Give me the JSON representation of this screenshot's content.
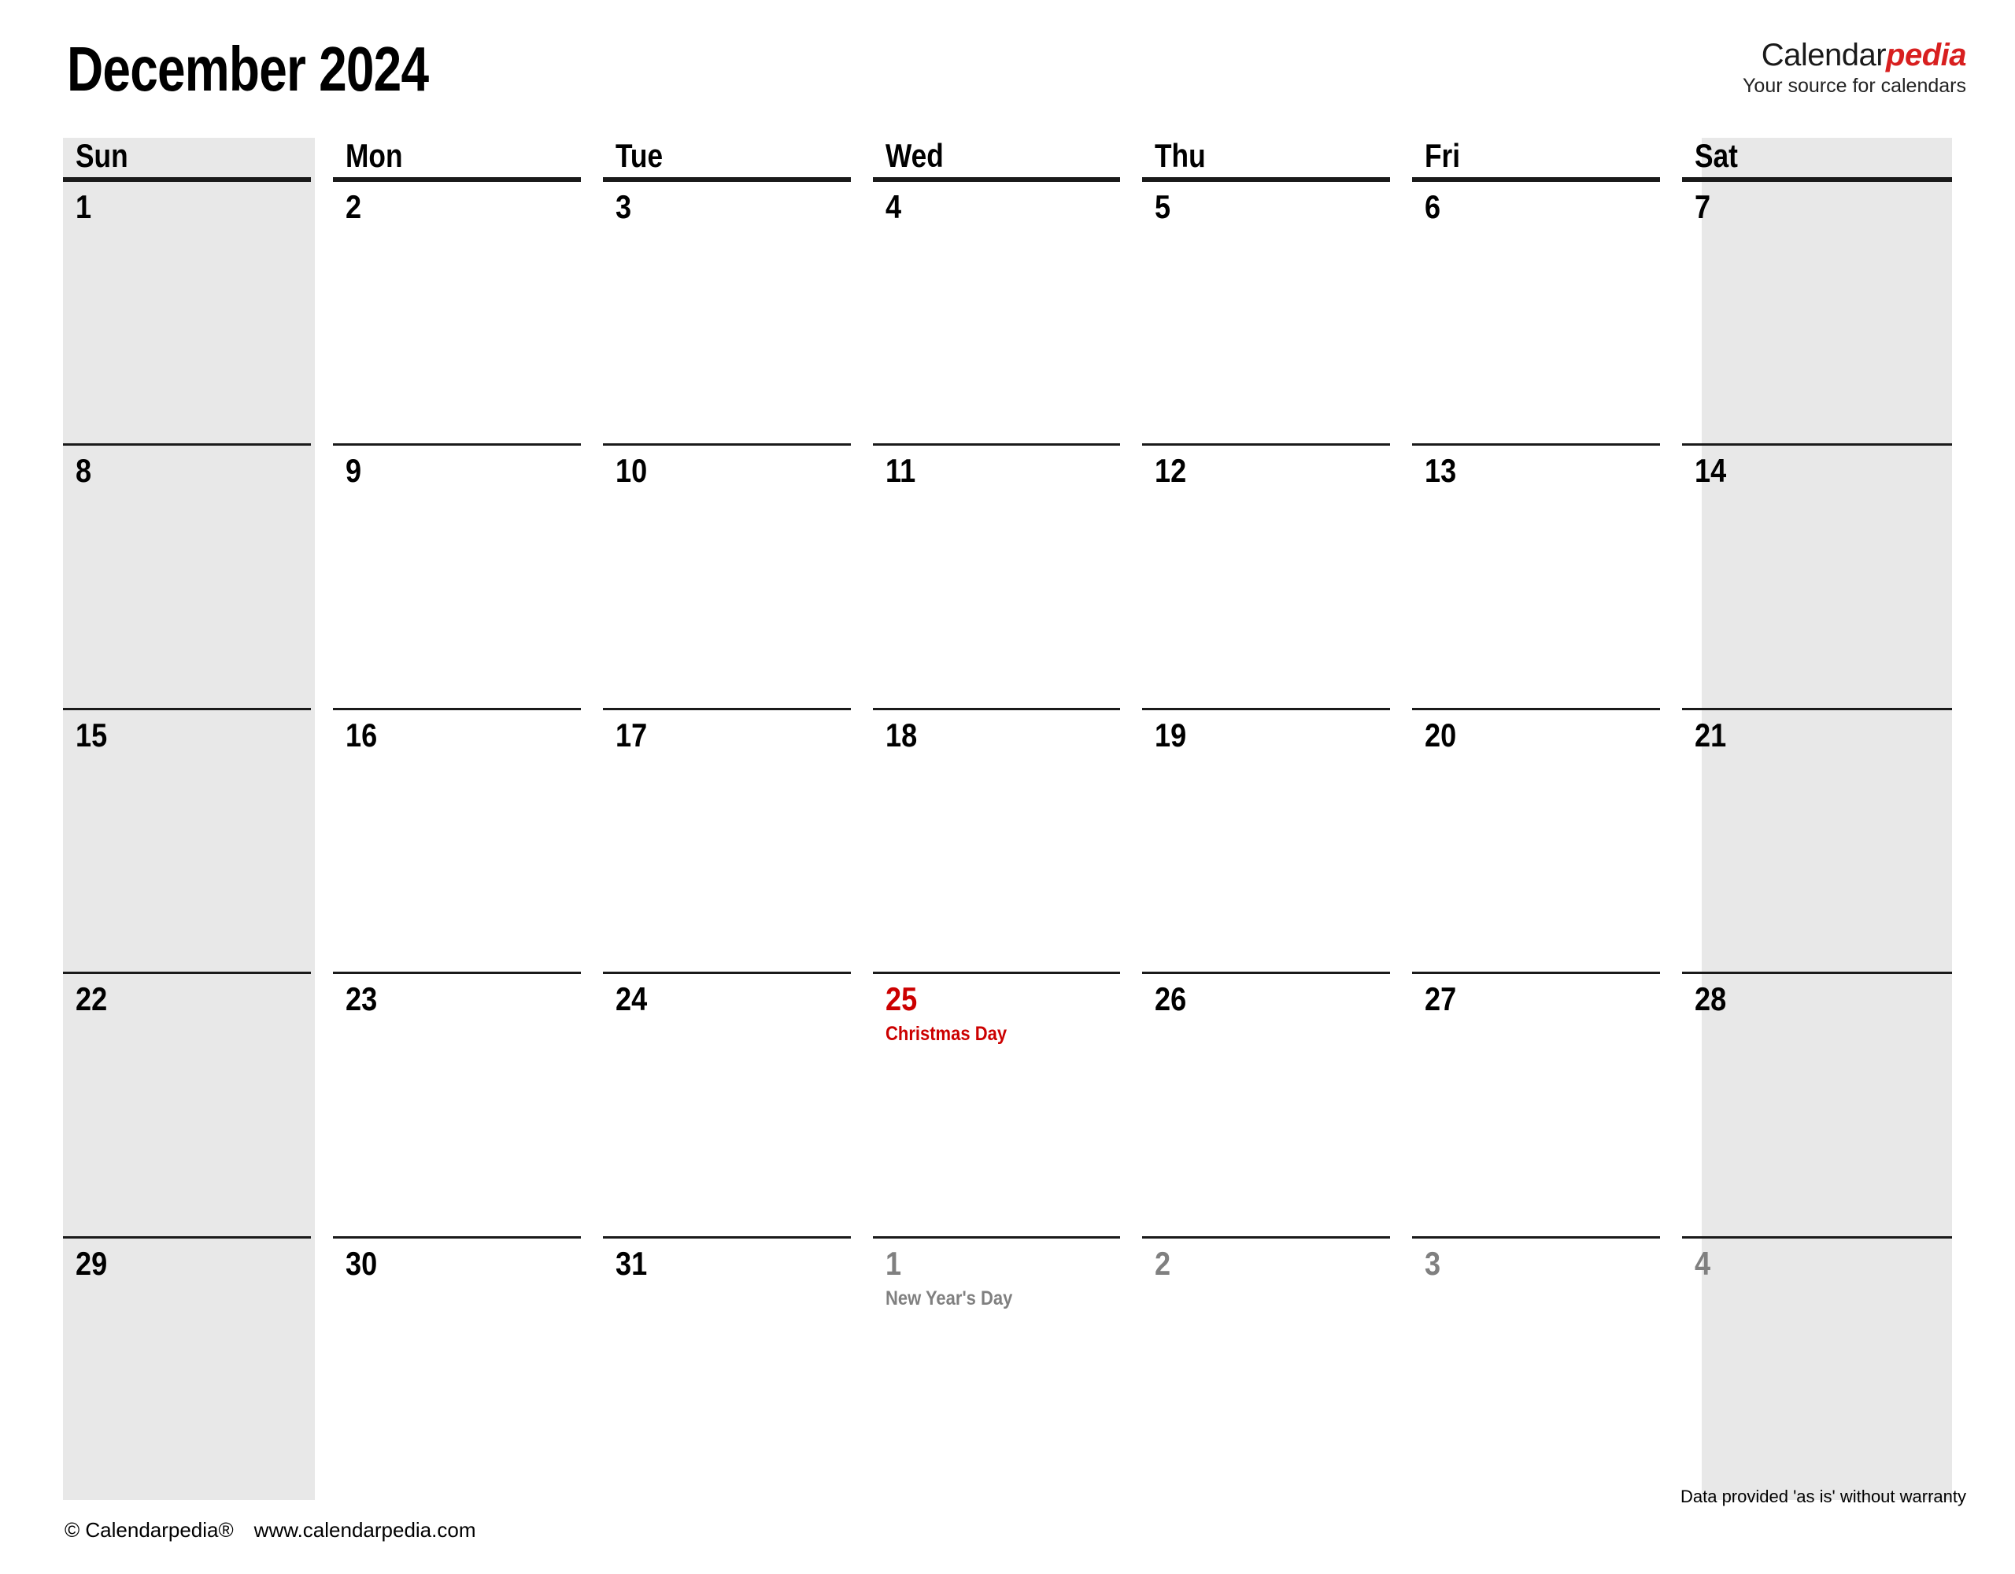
{
  "header": {
    "title": "December 2024",
    "logo": {
      "word_primary": "Calendar",
      "word_accent": "pedia",
      "tagline": "Your source for calendars",
      "accent_color": "#d81f1f"
    }
  },
  "calendar": {
    "month": "December",
    "year": "2024",
    "week_start": "Sun",
    "weekday_headers": [
      "Sun",
      "Mon",
      "Tue",
      "Wed",
      "Thu",
      "Fri",
      "Sat"
    ],
    "weekend_shade_color": "#e8e8e8",
    "holiday_color": "#cc0000",
    "other_month_color": "#808080",
    "weeks": [
      [
        {
          "day": "1",
          "event": "",
          "other": false,
          "holiday": false,
          "weekend": true
        },
        {
          "day": "2",
          "event": "",
          "other": false,
          "holiday": false,
          "weekend": false
        },
        {
          "day": "3",
          "event": "",
          "other": false,
          "holiday": false,
          "weekend": false
        },
        {
          "day": "4",
          "event": "",
          "other": false,
          "holiday": false,
          "weekend": false
        },
        {
          "day": "5",
          "event": "",
          "other": false,
          "holiday": false,
          "weekend": false
        },
        {
          "day": "6",
          "event": "",
          "other": false,
          "holiday": false,
          "weekend": false
        },
        {
          "day": "7",
          "event": "",
          "other": false,
          "holiday": false,
          "weekend": true
        }
      ],
      [
        {
          "day": "8",
          "event": "",
          "other": false,
          "holiday": false,
          "weekend": true
        },
        {
          "day": "9",
          "event": "",
          "other": false,
          "holiday": false,
          "weekend": false
        },
        {
          "day": "10",
          "event": "",
          "other": false,
          "holiday": false,
          "weekend": false
        },
        {
          "day": "11",
          "event": "",
          "other": false,
          "holiday": false,
          "weekend": false
        },
        {
          "day": "12",
          "event": "",
          "other": false,
          "holiday": false,
          "weekend": false
        },
        {
          "day": "13",
          "event": "",
          "other": false,
          "holiday": false,
          "weekend": false
        },
        {
          "day": "14",
          "event": "",
          "other": false,
          "holiday": false,
          "weekend": true
        }
      ],
      [
        {
          "day": "15",
          "event": "",
          "other": false,
          "holiday": false,
          "weekend": true
        },
        {
          "day": "16",
          "event": "",
          "other": false,
          "holiday": false,
          "weekend": false
        },
        {
          "day": "17",
          "event": "",
          "other": false,
          "holiday": false,
          "weekend": false
        },
        {
          "day": "18",
          "event": "",
          "other": false,
          "holiday": false,
          "weekend": false
        },
        {
          "day": "19",
          "event": "",
          "other": false,
          "holiday": false,
          "weekend": false
        },
        {
          "day": "20",
          "event": "",
          "other": false,
          "holiday": false,
          "weekend": false
        },
        {
          "day": "21",
          "event": "",
          "other": false,
          "holiday": false,
          "weekend": true
        }
      ],
      [
        {
          "day": "22",
          "event": "",
          "other": false,
          "holiday": false,
          "weekend": true
        },
        {
          "day": "23",
          "event": "",
          "other": false,
          "holiday": false,
          "weekend": false
        },
        {
          "day": "24",
          "event": "",
          "other": false,
          "holiday": false,
          "weekend": false
        },
        {
          "day": "25",
          "event": "Christmas Day",
          "other": false,
          "holiday": true,
          "weekend": false
        },
        {
          "day": "26",
          "event": "",
          "other": false,
          "holiday": false,
          "weekend": false
        },
        {
          "day": "27",
          "event": "",
          "other": false,
          "holiday": false,
          "weekend": false
        },
        {
          "day": "28",
          "event": "",
          "other": false,
          "holiday": false,
          "weekend": true
        }
      ],
      [
        {
          "day": "29",
          "event": "",
          "other": false,
          "holiday": false,
          "weekend": true
        },
        {
          "day": "30",
          "event": "",
          "other": false,
          "holiday": false,
          "weekend": false
        },
        {
          "day": "31",
          "event": "",
          "other": false,
          "holiday": false,
          "weekend": false
        },
        {
          "day": "1",
          "event": "New Year's Day",
          "other": true,
          "holiday": false,
          "weekend": false
        },
        {
          "day": "2",
          "event": "",
          "other": true,
          "holiday": false,
          "weekend": false
        },
        {
          "day": "3",
          "event": "",
          "other": true,
          "holiday": false,
          "weekend": false
        },
        {
          "day": "4",
          "event": "",
          "other": true,
          "holiday": false,
          "weekend": true
        }
      ]
    ]
  },
  "footer": {
    "copyright": "© Calendarpedia®",
    "website": "www.calendarpedia.com",
    "disclaimer": "Data provided 'as is' without warranty"
  }
}
